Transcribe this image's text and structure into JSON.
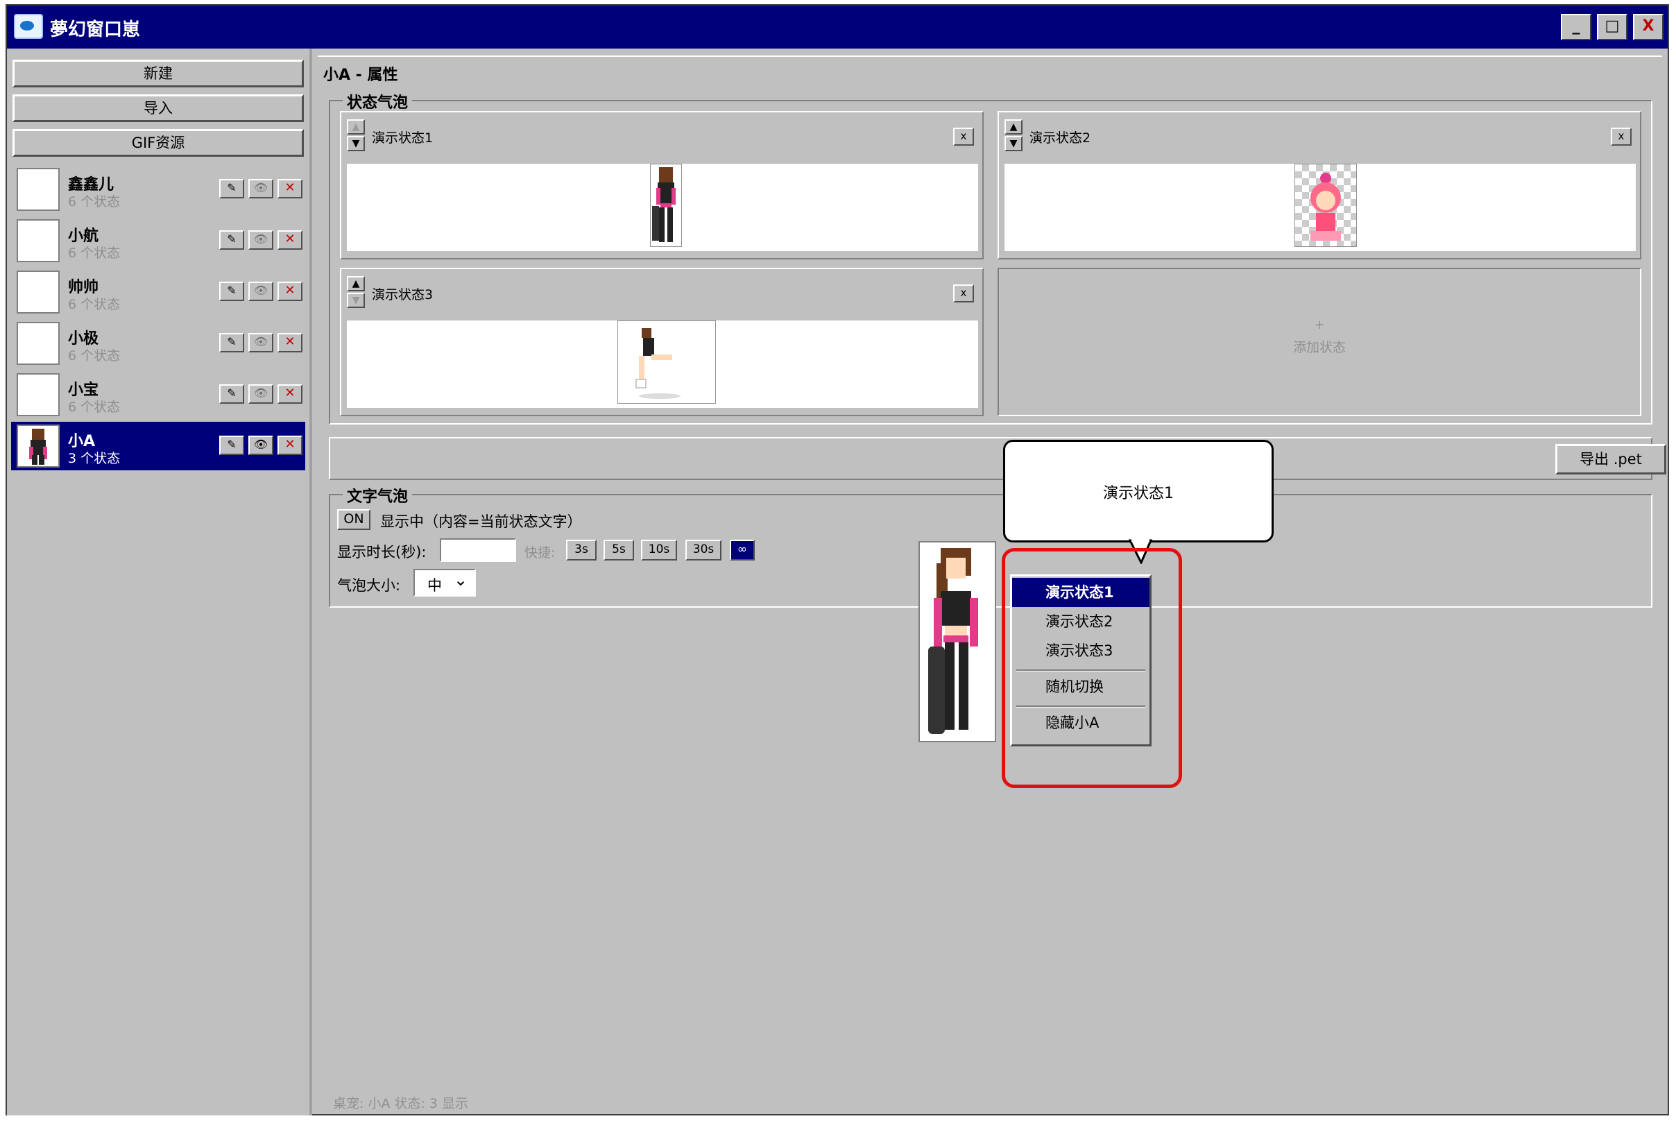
{
  "window": {
    "title": "夢幻窗口崽",
    "minimize": "_",
    "maximize": "□",
    "close": "X"
  },
  "sidebar": {
    "new_label": "新建",
    "import_label": "导入",
    "gif_label": "GIF资源",
    "pets": [
      {
        "name": "鑫鑫儿",
        "count": "6 个状态"
      },
      {
        "name": "小航",
        "count": "6 个状态"
      },
      {
        "name": "帅帅",
        "count": "6 个状态"
      },
      {
        "name": "小极",
        "count": "6 个状态"
      },
      {
        "name": "小宝",
        "count": "6 个状态"
      },
      {
        "name": "小A",
        "count": "3 个状态",
        "selected": true
      }
    ],
    "edit_icon": "✎",
    "view_icon": "👁",
    "delete_icon": "✕"
  },
  "main": {
    "title": "小A - 属性",
    "state_group": "状态气泡",
    "states": [
      {
        "name": "演示状态1"
      },
      {
        "name": "演示状态2"
      },
      {
        "name": "演示状态3"
      }
    ],
    "remove_label": "x",
    "up_arrow": "▲",
    "down_arrow": "▼",
    "add_plus": "+",
    "add_label": "添加状态",
    "export_label": "导出 .pet",
    "text_group": "文字气泡",
    "on_label": "ON",
    "on_desc": "显示中（内容=当前状态文字）",
    "duration_label": "显示时长(秒):",
    "duration_value": "",
    "quick_label": "快捷:",
    "quick_options": [
      "3s",
      "5s",
      "10s",
      "30s",
      "∞"
    ],
    "size_label": "气泡大小:",
    "size_value": "中",
    "size_chevron": "⌄"
  },
  "bubble": {
    "text": "演示状态1"
  },
  "context_menu": {
    "items": [
      "演示状态1",
      "演示状态2",
      "演示状态3",
      "随机切换",
      "隐藏小A"
    ]
  },
  "status_bar": "桌宠: 小A   状态: 3   显示",
  "colors": {
    "titlebar": "#00007a",
    "face": "#c0c0c0",
    "highlight": "#e01010"
  }
}
